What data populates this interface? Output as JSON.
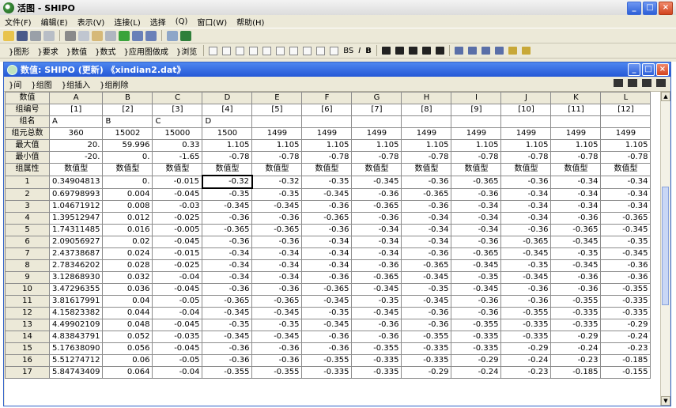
{
  "app": {
    "title": "活图 - SHIPO",
    "menu": [
      "文件(F)",
      "编辑(E)",
      "表示(V)",
      "连接(L)",
      "选择",
      "(Q)",
      "窗口(W)",
      "帮助(H)"
    ]
  },
  "toolbar2": {
    "items": [
      "}图形",
      "}要求",
      "}数值",
      "}数式",
      "}应用图做成",
      "}浏览"
    ],
    "format_labels": [
      "BS",
      "I",
      "B"
    ]
  },
  "child_window": {
    "title": "数值: SHIPO (更新) 《xindian2.dat》",
    "toolbar": [
      "}间",
      "}组图",
      "}组插入",
      "}组削除"
    ]
  },
  "grid": {
    "columns": [
      "A",
      "B",
      "C",
      "D",
      "E",
      "F",
      "G",
      "H",
      "I",
      "J",
      "K",
      "L"
    ],
    "meta_rows": [
      {
        "label": "数值",
        "values": [
          "A",
          "B",
          "C",
          "D",
          "E",
          "F",
          "G",
          "H",
          "I",
          "J",
          "K",
          "L"
        ]
      },
      {
        "label": "组编号",
        "values": [
          "[1]",
          "[2]",
          "[3]",
          "[4]",
          "[5]",
          "[6]",
          "[7]",
          "[8]",
          "[9]",
          "[10]",
          "[11]",
          "[12]"
        ]
      },
      {
        "label": "组名",
        "values": [
          "A",
          "B",
          "C",
          "D",
          "",
          "",
          "",
          "",
          "",
          "",
          "",
          ""
        ]
      },
      {
        "label": "组元总数",
        "values": [
          "360",
          "15002",
          "15000",
          "1500",
          "1499",
          "1499",
          "1499",
          "1499",
          "1499",
          "1499",
          "1499",
          "1499"
        ]
      },
      {
        "label": "最大值",
        "values": [
          "20.",
          "59.996",
          "0.33",
          "1.105",
          "1.105",
          "1.105",
          "1.105",
          "1.105",
          "1.105",
          "1.105",
          "1.105",
          "1.105"
        ]
      },
      {
        "label": "最小值",
        "values": [
          "-20.",
          "0.",
          "-1.65",
          "-0.78",
          "-0.78",
          "-0.78",
          "-0.78",
          "-0.78",
          "-0.78",
          "-0.78",
          "-0.78",
          "-0.78"
        ]
      },
      {
        "label": "组属性",
        "values": [
          "数值型",
          "数值型",
          "数值型",
          "数值型",
          "数值型",
          "数值型",
          "数值型",
          "数值型",
          "数值型",
          "数值型",
          "数值型",
          "数值型"
        ]
      }
    ],
    "rows": [
      {
        "n": "1",
        "cells": [
          "0.34904813",
          "0.",
          "-0.015",
          "-0.32",
          "-0.32",
          "-0.35",
          "-0.345",
          "-0.36",
          "-0.365",
          "-0.36",
          "-0.34",
          "-0.34"
        ]
      },
      {
        "n": "2",
        "cells": [
          "0.69798993",
          "0.004",
          "-0.045",
          "-0.35",
          "-0.35",
          "-0.345",
          "-0.36",
          "-0.365",
          "-0.36",
          "-0.34",
          "-0.34",
          "-0.34"
        ]
      },
      {
        "n": "3",
        "cells": [
          "1.04671912",
          "0.008",
          "-0.03",
          "-0.345",
          "-0.345",
          "-0.36",
          "-0.365",
          "-0.36",
          "-0.34",
          "-0.34",
          "-0.34",
          "-0.34"
        ]
      },
      {
        "n": "4",
        "cells": [
          "1.39512947",
          "0.012",
          "-0.025",
          "-0.36",
          "-0.36",
          "-0.365",
          "-0.36",
          "-0.34",
          "-0.34",
          "-0.34",
          "-0.36",
          "-0.365"
        ]
      },
      {
        "n": "5",
        "cells": [
          "1.74311485",
          "0.016",
          "-0.005",
          "-0.365",
          "-0.365",
          "-0.36",
          "-0.34",
          "-0.34",
          "-0.34",
          "-0.36",
          "-0.365",
          "-0.345"
        ]
      },
      {
        "n": "6",
        "cells": [
          "2.09056927",
          "0.02",
          "-0.045",
          "-0.36",
          "-0.36",
          "-0.34",
          "-0.34",
          "-0.34",
          "-0.36",
          "-0.365",
          "-0.345",
          "-0.35"
        ]
      },
      {
        "n": "7",
        "cells": [
          "2.43738687",
          "0.024",
          "-0.015",
          "-0.34",
          "-0.34",
          "-0.34",
          "-0.34",
          "-0.36",
          "-0.365",
          "-0.345",
          "-0.35",
          "-0.345"
        ]
      },
      {
        "n": "8",
        "cells": [
          "2.78346202",
          "0.028",
          "-0.025",
          "-0.34",
          "-0.34",
          "-0.34",
          "-0.36",
          "-0.365",
          "-0.345",
          "-0.35",
          "-0.345",
          "-0.36"
        ]
      },
      {
        "n": "9",
        "cells": [
          "3.12868930",
          "0.032",
          "-0.04",
          "-0.34",
          "-0.34",
          "-0.36",
          "-0.365",
          "-0.345",
          "-0.35",
          "-0.345",
          "-0.36",
          "-0.36"
        ]
      },
      {
        "n": "10",
        "cells": [
          "3.47296355",
          "0.036",
          "-0.045",
          "-0.36",
          "-0.36",
          "-0.365",
          "-0.345",
          "-0.35",
          "-0.345",
          "-0.36",
          "-0.36",
          "-0.355"
        ]
      },
      {
        "n": "11",
        "cells": [
          "3.81617991",
          "0.04",
          "-0.05",
          "-0.365",
          "-0.365",
          "-0.345",
          "-0.35",
          "-0.345",
          "-0.36",
          "-0.36",
          "-0.355",
          "-0.335"
        ]
      },
      {
        "n": "12",
        "cells": [
          "4.15823382",
          "0.044",
          "-0.04",
          "-0.345",
          "-0.345",
          "-0.35",
          "-0.345",
          "-0.36",
          "-0.36",
          "-0.355",
          "-0.335",
          "-0.335"
        ]
      },
      {
        "n": "13",
        "cells": [
          "4.49902109",
          "0.048",
          "-0.045",
          "-0.35",
          "-0.35",
          "-0.345",
          "-0.36",
          "-0.36",
          "-0.355",
          "-0.335",
          "-0.335",
          "-0.29"
        ]
      },
      {
        "n": "14",
        "cells": [
          "4.83843791",
          "0.052",
          "-0.035",
          "-0.345",
          "-0.345",
          "-0.36",
          "-0.36",
          "-0.355",
          "-0.335",
          "-0.335",
          "-0.29",
          "-0.24"
        ]
      },
      {
        "n": "15",
        "cells": [
          "5.17638090",
          "0.056",
          "-0.045",
          "-0.36",
          "-0.36",
          "-0.36",
          "-0.355",
          "-0.335",
          "-0.335",
          "-0.29",
          "-0.24",
          "-0.23"
        ]
      },
      {
        "n": "16",
        "cells": [
          "5.51274712",
          "0.06",
          "-0.05",
          "-0.36",
          "-0.36",
          "-0.355",
          "-0.335",
          "-0.335",
          "-0.29",
          "-0.24",
          "-0.23",
          "-0.185"
        ]
      },
      {
        "n": "17",
        "cells": [
          "5.84743409",
          "0.064",
          "-0.04",
          "-0.355",
          "-0.355",
          "-0.335",
          "-0.335",
          "-0.29",
          "-0.24",
          "-0.23",
          "-0.185",
          "-0.155"
        ]
      }
    ]
  },
  "colors": {
    "title_gradient": "#2558d6",
    "chrome_bg": "#ece9d8",
    "grid_line": "#8c8c8c"
  }
}
